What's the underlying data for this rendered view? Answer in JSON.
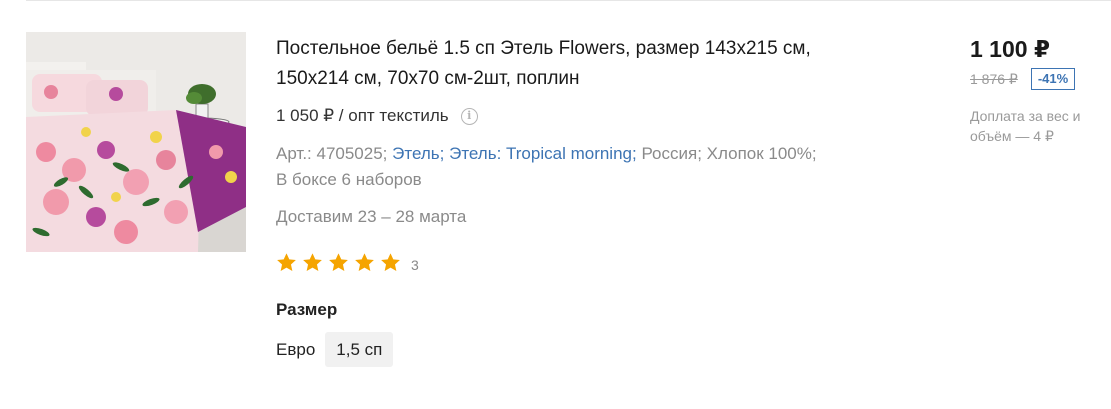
{
  "product": {
    "title": "Постельное бельё 1.5 сп Этель Flowers, размер 143х215 см, 150х214 см, 70х70 см-2шт, поплин",
    "wholesale_text": "1 050 ₽ / опт текстиль",
    "info_icon": "info-icon",
    "meta": {
      "article": "Арт.: 4705025;",
      "brand_link": "Этель;",
      "series_link": "Этель: Tropical morning;",
      "country": "Россия;",
      "material": "Хлопок 100%;",
      "box": "В боксе 6 наборов"
    },
    "delivery": "Доставим 23 – 28 марта",
    "rating": {
      "stars": 5,
      "max": 5,
      "count": "3",
      "star_color": "#f5a400"
    },
    "size": {
      "label": "Размер",
      "options": [
        "Евро",
        "1,5 сп"
      ],
      "selected": "1,5 сп"
    }
  },
  "pricing": {
    "price": "1 100 ₽",
    "old_price": "1 876 ₽",
    "discount": "-41%",
    "surcharge": "Доплата за вес и объём — 4 ₽"
  },
  "colors": {
    "link": "#3d74b3",
    "muted": "#8a8a8a",
    "star": "#f5a400"
  }
}
